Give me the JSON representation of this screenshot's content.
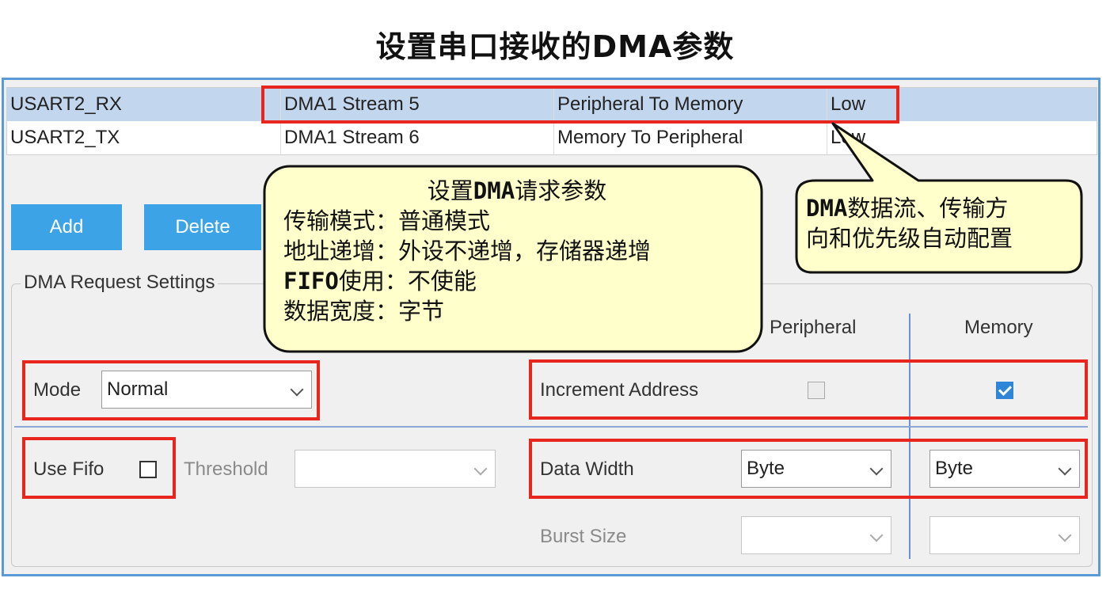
{
  "title": "设置串口接收的DMA参数",
  "dma_table": {
    "rows": [
      {
        "request": "USART2_RX",
        "channel": "DMA1 Stream 5",
        "direction": "Peripheral To Memory",
        "priority": "Low",
        "selected": true
      },
      {
        "request": "USART2_TX",
        "channel": "DMA1 Stream 6",
        "direction": "Memory To Peripheral",
        "priority": "Low",
        "selected": false
      }
    ]
  },
  "buttons": {
    "add": "Add",
    "delete": "Delete"
  },
  "settings": {
    "group_label": "DMA Request Settings",
    "col_peripheral": "Peripheral",
    "col_memory": "Memory",
    "mode_label": "Mode",
    "mode_value": "Normal",
    "increment_label": "Increment Address",
    "increment_peripheral": false,
    "increment_memory": true,
    "use_fifo_label": "Use Fifo",
    "use_fifo": false,
    "threshold_label": "Threshold",
    "threshold_value": "",
    "data_width_label": "Data Width",
    "data_width_peripheral": "Byte",
    "data_width_memory": "Byte",
    "burst_size_label": "Burst Size",
    "burst_peripheral": "",
    "burst_memory": ""
  },
  "callout_left": {
    "title_pre": "设置",
    "title_bold": "DMA",
    "title_post": "请求参数",
    "line1": "传输模式：普通模式",
    "line2": "地址递增：外设不递增，存储器递增",
    "line3_bold": "FIFO",
    "line3_rest": "使用：不使能",
    "line4": "数据宽度：字节"
  },
  "callout_right": {
    "line1_bold": "DMA",
    "line1_rest": "数据流、传输方",
    "line2": "向和优先级自动配置"
  },
  "colors": {
    "highlight": "#e8261e",
    "callout_fill": "#ffffcc",
    "button": "#3ba3e6",
    "selected_row": "#c2d6ee",
    "panel_border": "#5b9bd5"
  }
}
